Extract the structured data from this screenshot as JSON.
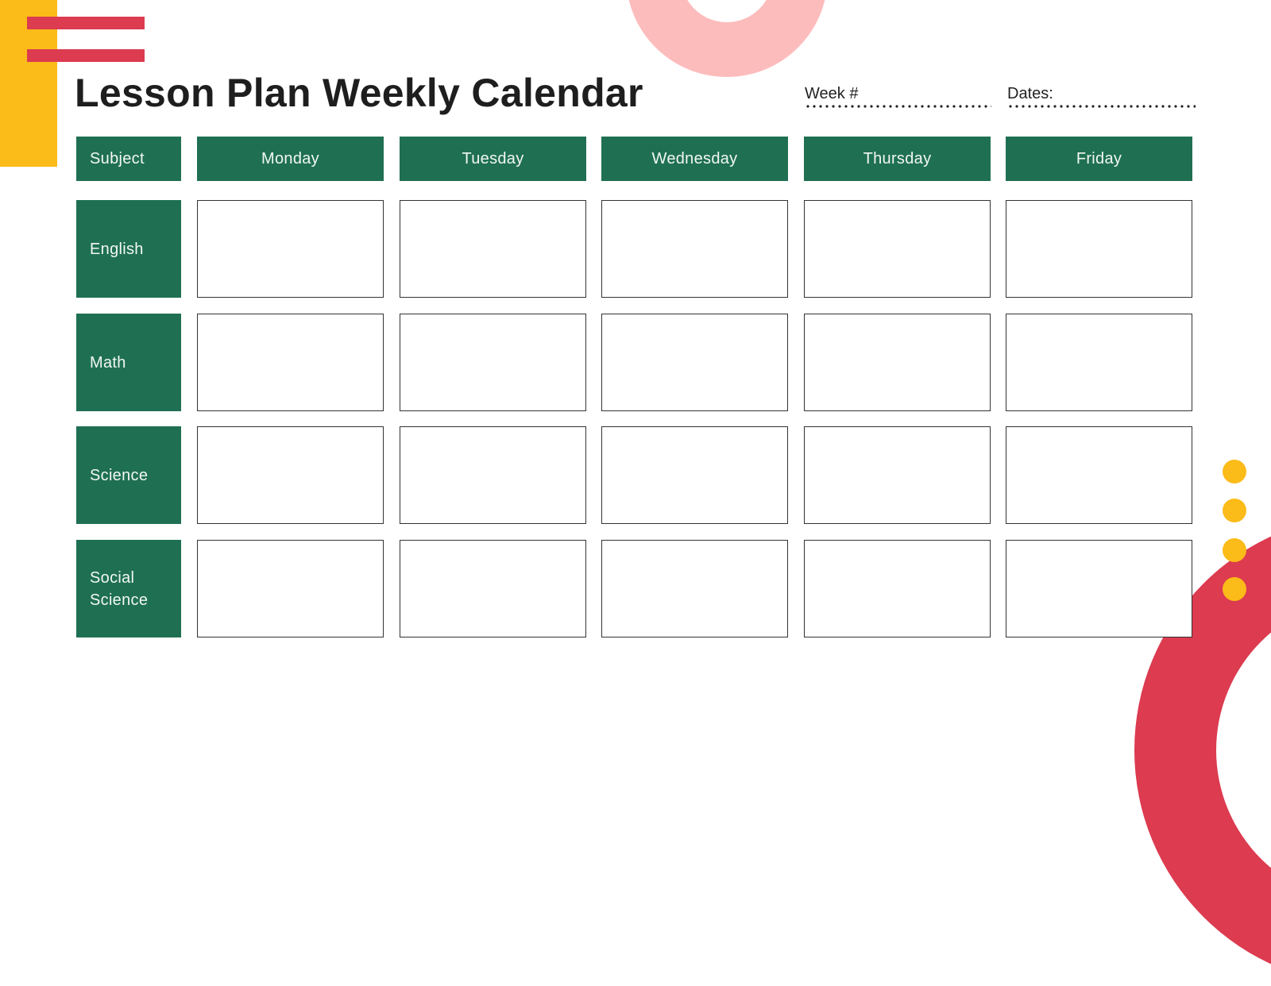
{
  "title": "Lesson Plan Weekly Calendar",
  "meta": {
    "week_label": "Week #",
    "week_value": "",
    "dates_label": "Dates:",
    "dates_value": ""
  },
  "table": {
    "subject_header": "Subject",
    "days": [
      "Monday",
      "Tuesday",
      "Wednesday",
      "Thursday",
      "Friday"
    ],
    "subjects": [
      "English",
      "Math",
      "Science",
      "Social Science"
    ],
    "cells": [
      [
        "",
        "",
        "",
        "",
        ""
      ],
      [
        "",
        "",
        "",
        "",
        ""
      ],
      [
        "",
        "",
        "",
        "",
        ""
      ],
      [
        "",
        "",
        "",
        "",
        ""
      ]
    ]
  },
  "colors": {
    "header_green": "#1f7052",
    "accent_yellow": "#fbbb18",
    "accent_red": "#dc3b50",
    "accent_pink": "#fdbcbc",
    "border": "#333333"
  }
}
